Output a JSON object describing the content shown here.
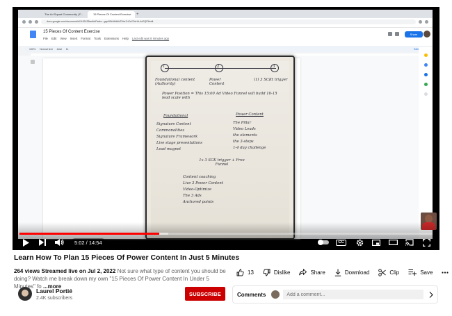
{
  "video": {
    "title": "Learn How To Plan 15 Pieces Of Power Content In Just 5 Minutes",
    "views": "264 views",
    "streamed": "Streamed live on Jul 2, 2022",
    "description": "Not sure what type of content you should be doing? Watch me break down my own \"15 Pieces Of Power Content In Under 5 Minutes\" fo",
    "more_label": "...more"
  },
  "player": {
    "time_current": "5:02",
    "time_total": "14:54",
    "time_display": "5:02 / 14:54",
    "progress": 0.338,
    "buffered": 0.36,
    "accent_color": "#ff0000"
  },
  "screen": {
    "tabs": [
      "The Ad Squad Community | F...",
      "15 Pieces Of Content Exercise"
    ],
    "url": "docs.google.com/document/d/1HO4Z8wsNzPsdm...gqcNWvf6dbhZXbs7nZxXOvHd-4cEQPf/edit",
    "doc_title": "15 Pieces Of Content Exercise",
    "menus": [
      "File",
      "Edit",
      "View",
      "Insert",
      "Format",
      "Tools",
      "Extensions",
      "Help"
    ],
    "last_edit": "Last edit was 8 minutes ago",
    "share_label": "Share",
    "editing_label": "Editing",
    "toolbar": [
      "100%",
      "Normal text",
      "Arial",
      "11"
    ]
  },
  "notebook": {
    "circles": [
      "1",
      "2",
      "3"
    ],
    "top_labels": [
      "Foundational content (Authority)",
      "Power Content",
      "(1) 3 SCKt trigger"
    ],
    "power_line": "Power Position = This 15:00 Ad Video Funnel will build 10-15 lead scale with",
    "left_heading": "Foundational",
    "left_items": [
      "Signature Content",
      "Commonalities",
      "Signature Framework",
      "Live stage presentations",
      "Lead magnet"
    ],
    "right_heading": "Power Content",
    "right_items": [
      "The Pillar",
      "Video Leads",
      "the elements",
      "the 3-steps",
      "1-4 day challenge"
    ],
    "bottom_heading": "1x 3 SCK trigger + Free Funnel",
    "bottom_items": [
      "Content coaching",
      "Live 3 Power Content",
      "Video-Optimize",
      "The 3 Ads",
      "Anchored points"
    ]
  },
  "actions": {
    "like_count": "13",
    "dislike_label": "Dislike",
    "share_label": "Share",
    "download_label": "Download",
    "clip_label": "Clip",
    "save_label": "Save"
  },
  "channel": {
    "name": "Laurel Portié",
    "subscribers": "2.4K subscribers",
    "subscribe_label": "SUBSCRIBE"
  },
  "comments": {
    "label": "Comments",
    "placeholder": "Add a comment..."
  }
}
